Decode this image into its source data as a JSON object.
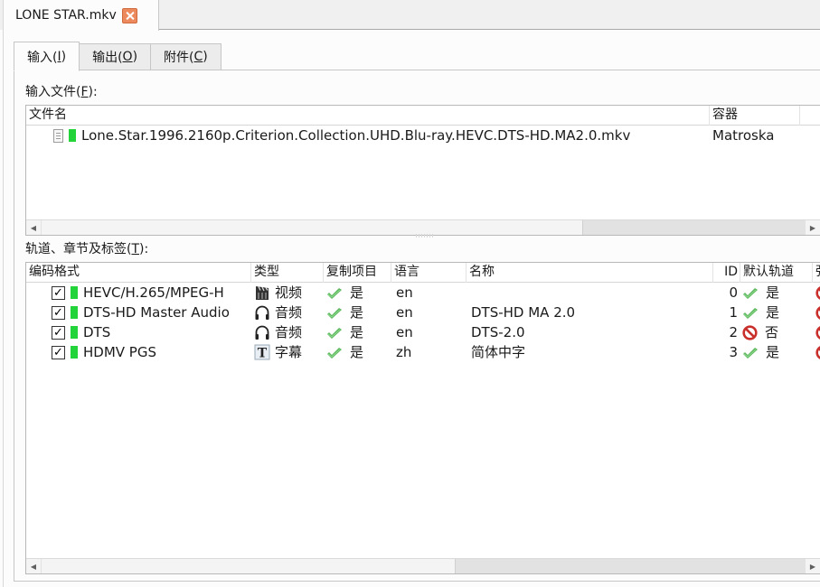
{
  "window": {
    "file_tab": {
      "label": "LONE STAR.mkv",
      "close_icon": "close-x-icon",
      "close_color": "#ec8a5e"
    }
  },
  "subtabs": [
    {
      "label": "输入(",
      "mnemonic": "I",
      "suffix": ")",
      "active": true
    },
    {
      "label": "输出(",
      "mnemonic": "O",
      "suffix": ")",
      "active": false
    },
    {
      "label": "附件(",
      "mnemonic": "C",
      "suffix": ")",
      "active": false
    }
  ],
  "input_files": {
    "label": "输入文件(",
    "mnemonic": "F",
    "suffix": "):",
    "columns": [
      "文件名",
      "容器"
    ],
    "rows": [
      {
        "icon": "file-icon",
        "name": "Lone.Star.1996.2160p.Criterion.Collection.UHD.Blu-ray.HEVC.DTS-HD.MA2.0.mkv",
        "container": "Matroska"
      }
    ]
  },
  "tracks": {
    "label": "轨道、章节及标签(",
    "mnemonic": "T",
    "suffix": "):",
    "columns": [
      "编码格式",
      "类型",
      "复制项目",
      "语言",
      "名称",
      "ID",
      "默认轨道",
      "强"
    ],
    "rows": [
      {
        "checked": true,
        "codec": "HEVC/H.265/MPEG-H",
        "type_icon": "video-clapper-icon",
        "type": "视频",
        "copy": "是",
        "language": "en",
        "name": "",
        "id": "0",
        "default_icon": "check-icon",
        "default": "是"
      },
      {
        "checked": true,
        "codec": "DTS-HD Master Audio",
        "type_icon": "headphones-icon",
        "type": "音频",
        "copy": "是",
        "language": "en",
        "name": "DTS-HD MA 2.0",
        "id": "1",
        "default_icon": "check-icon",
        "default": "是"
      },
      {
        "checked": true,
        "codec": "DTS",
        "type_icon": "headphones-icon",
        "type": "音频",
        "copy": "是",
        "language": "en",
        "name": "DTS-2.0",
        "id": "2",
        "default_icon": "no-icon",
        "default": "否"
      },
      {
        "checked": true,
        "codec": "HDMV PGS",
        "type_icon": "subtitle-t-icon",
        "type": "字幕",
        "copy": "是",
        "language": "zh",
        "name": "简体中字",
        "id": "3",
        "default_icon": "check-icon",
        "default": "是"
      }
    ]
  },
  "colors": {
    "track_marker": "#22d33a",
    "check": "#5cb85c",
    "no": "#c9302c"
  }
}
